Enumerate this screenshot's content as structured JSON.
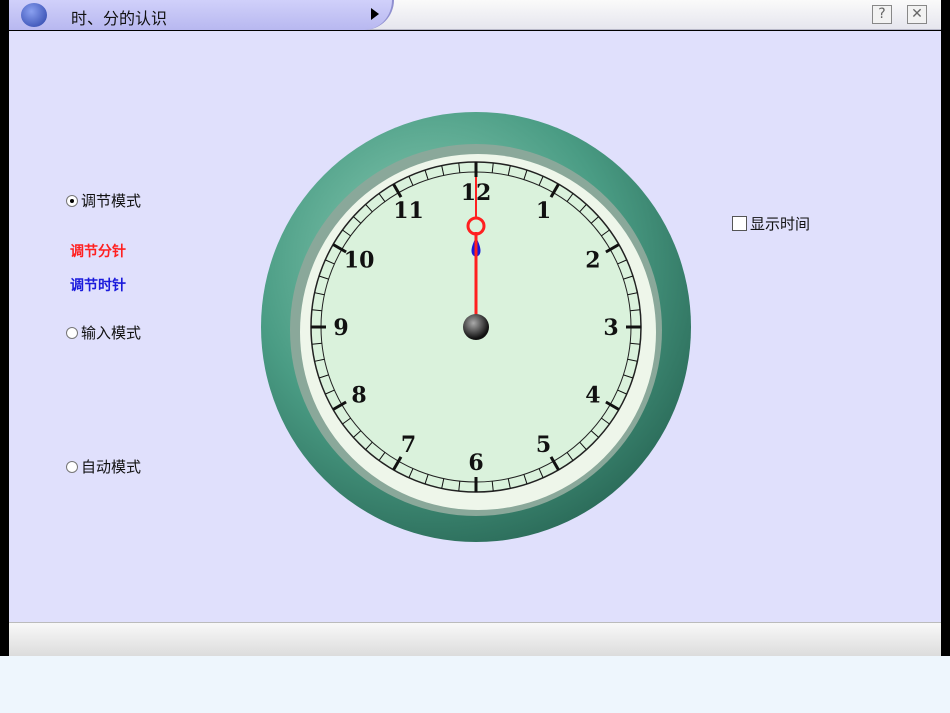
{
  "window": {
    "title": "时、分的认识",
    "logo": "R",
    "help_label": "?",
    "close_label": "✕"
  },
  "modes": [
    {
      "label": "调节模式",
      "selected": true
    },
    {
      "label": "输入模式",
      "selected": false
    },
    {
      "label": "自动模式",
      "selected": false
    }
  ],
  "adjust": {
    "minute_label": "调节分针",
    "hour_label": "调节时针",
    "minute_color": "#ff2020",
    "hour_color": "#1a1adc"
  },
  "show_time": {
    "label": "显示时间",
    "checked": false
  },
  "clock": {
    "numbers": [
      "12",
      "1",
      "2",
      "3",
      "4",
      "5",
      "6",
      "7",
      "8",
      "9",
      "10",
      "11"
    ],
    "hour": 12,
    "minute": 0
  }
}
